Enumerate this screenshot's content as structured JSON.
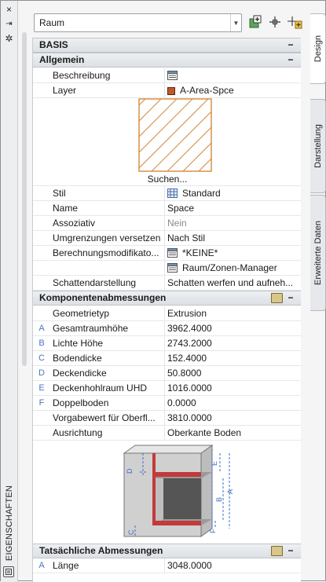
{
  "panel": {
    "title": "EIGENSCHAFTEN",
    "close_icon": "×",
    "pin_icon": "⇥",
    "settings_icon": "✲"
  },
  "toolbar": {
    "object_select": "Raum"
  },
  "tabs": [
    {
      "label": "Design",
      "active": true
    },
    {
      "label": "Darstellung",
      "active": false
    },
    {
      "label": "Erweiterte Daten",
      "active": false
    }
  ],
  "categories": {
    "basis": "BASIS",
    "allgemein": "Allgemein",
    "komponenten": "Komponentenabmessungen",
    "tatsaechlich": "Tatsächliche Abmessungen"
  },
  "allgemein": {
    "beschreibung_label": "Beschreibung",
    "layer_label": "Layer",
    "layer_value": "A-Area-Spce",
    "layer_color": "#c0582a",
    "search_label": "Suchen...",
    "stil_label": "Stil",
    "stil_value": "Standard",
    "name_label": "Name",
    "name_value": "Space",
    "assoziativ_label": "Assoziativ",
    "assoziativ_value": "Nein",
    "umgrenzungen_label": "Umgrenzungen versetzen",
    "umgrenzungen_value": "Nach Stil",
    "berechnung_label": "Berechnungsmodifikato...",
    "berechnung_value": "*KEINE*",
    "raum_zonen_value": "Raum/Zonen-Manager",
    "schatten_label": "Schattendarstellung",
    "schatten_value": "Schatten werfen und aufneh..."
  },
  "komponenten": {
    "rows": [
      {
        "letter": "",
        "label": "Geometrietyp",
        "value": "Extrusion"
      },
      {
        "letter": "A",
        "label": "Gesamtraumhöhe",
        "value": "3962.4000"
      },
      {
        "letter": "B",
        "label": "Lichte Höhe",
        "value": "2743.2000"
      },
      {
        "letter": "C",
        "label": "Bodendicke",
        "value": "152.4000"
      },
      {
        "letter": "D",
        "label": "Deckendicke",
        "value": "50.8000"
      },
      {
        "letter": "E",
        "label": "Deckenhohlraum UHD",
        "value": "1016.0000"
      },
      {
        "letter": "F",
        "label": "Doppelboden",
        "value": "0.0000"
      },
      {
        "letter": "",
        "label": "Vorgabewert für Oberfl...",
        "value": "3810.0000"
      },
      {
        "letter": "",
        "label": "Ausrichtung",
        "value": "Oberkante Boden"
      }
    ],
    "diagram_labels": [
      "D",
      "E",
      "B",
      "A",
      "C",
      "F"
    ]
  },
  "tatsaechlich": {
    "rows": [
      {
        "letter": "A",
        "label": "Länge",
        "value": "3048.0000"
      }
    ]
  },
  "colors": {
    "accent_letter": "#4a76b8",
    "hatch": "#d28a3c",
    "section_red": "#c23a3a"
  }
}
